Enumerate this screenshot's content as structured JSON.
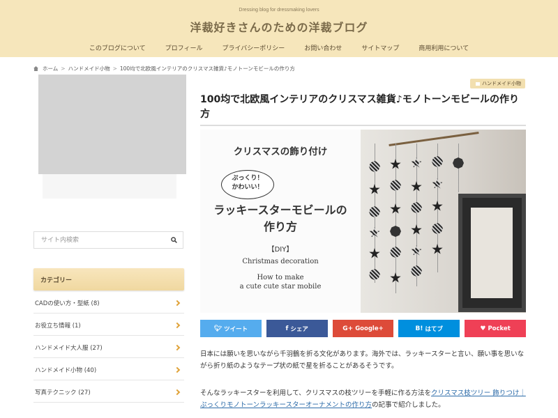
{
  "header": {
    "tagline": "Dressing blog for dressmaking lovers",
    "site_title": "洋裁好きさんのための洋裁ブログ",
    "nav": [
      "このブログについて",
      "プロフィール",
      "プライバシーポリシー",
      "お問い合わせ",
      "サイトマップ",
      "商用利用について"
    ]
  },
  "breadcrumb": {
    "home": "ホーム",
    "category": "ハンドメイド小物",
    "current": "100均で北欧風インテリアのクリスマス雑貨♪モノトーンモビールの作り方"
  },
  "sidebar": {
    "search_placeholder": "サイト内検索",
    "categories_title": "カテゴリー",
    "categories": [
      "CADの使い方・型紙 (8)",
      "お役立ち情報 (1)",
      "ハンドメイド大人服 (27)",
      "ハンドメイド小物 (40)",
      "写真テクニック (27)"
    ]
  },
  "article": {
    "category_tag": "ハンドメイド小物",
    "title": "100均で北欧風インテリアのクリスマス雑貨♪モノトーンモビールの作り方",
    "hero": {
      "heading": "クリスマスの飾り付け",
      "bubble_line1": "ぷっくり！",
      "bubble_line2": "かわいい！",
      "main_line1": "ラッキースターモビールの",
      "main_line2": "作り方",
      "diy": "【DIY】",
      "en1": "Christmas decoration",
      "en2_line1": "How to make",
      "en2_line2": "a cute cute star mobile"
    },
    "share": {
      "twitter": "ツイート",
      "facebook": "シェア",
      "google": "Google+",
      "hatena": "はてブ",
      "pocket": "Pocket"
    },
    "para1": "日本には願いを思いながら千羽鶴を折る文化があります。海外では、ラッキースターと言い、願い事を思いながら折り紙のようなテープ状の紙で星を折ることがあるそうです。",
    "para2_prefix": "そんなラッキースターを利用して、クリスマスの枝ツリーを手軽に作る方法を",
    "para2_link": "クリスマス枝ツリー 飾りつけ｜ぷっくりモノトーンラッキースターオーナメントの作り方",
    "para2_suffix": "の記事で紹介しました。"
  },
  "colors": {
    "header_bg": "#f6e6bb",
    "accent": "#e0a33a",
    "link": "#2a6aa8"
  }
}
